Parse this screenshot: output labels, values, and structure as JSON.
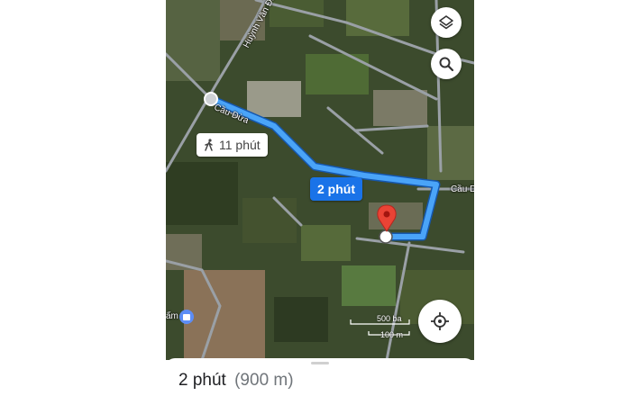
{
  "map": {
    "roads": [
      "Huỳnh Văn Đành",
      "Cầu Dừa",
      "Cầu D"
    ],
    "walk_label": "11 phút",
    "drive_label": "2 phút",
    "poi_label": "ấm",
    "scale": {
      "large": "500 ba",
      "small": "100 m"
    }
  },
  "controls": {
    "layers_icon": "layers-icon",
    "search_icon": "search-icon",
    "location_icon": "my-location-icon"
  },
  "sheet": {
    "duration": "2 phút",
    "distance": "(900 m)"
  },
  "colors": {
    "route": "#4285f4",
    "route_badge": "#1a73e8",
    "pin": "#ea4335"
  }
}
